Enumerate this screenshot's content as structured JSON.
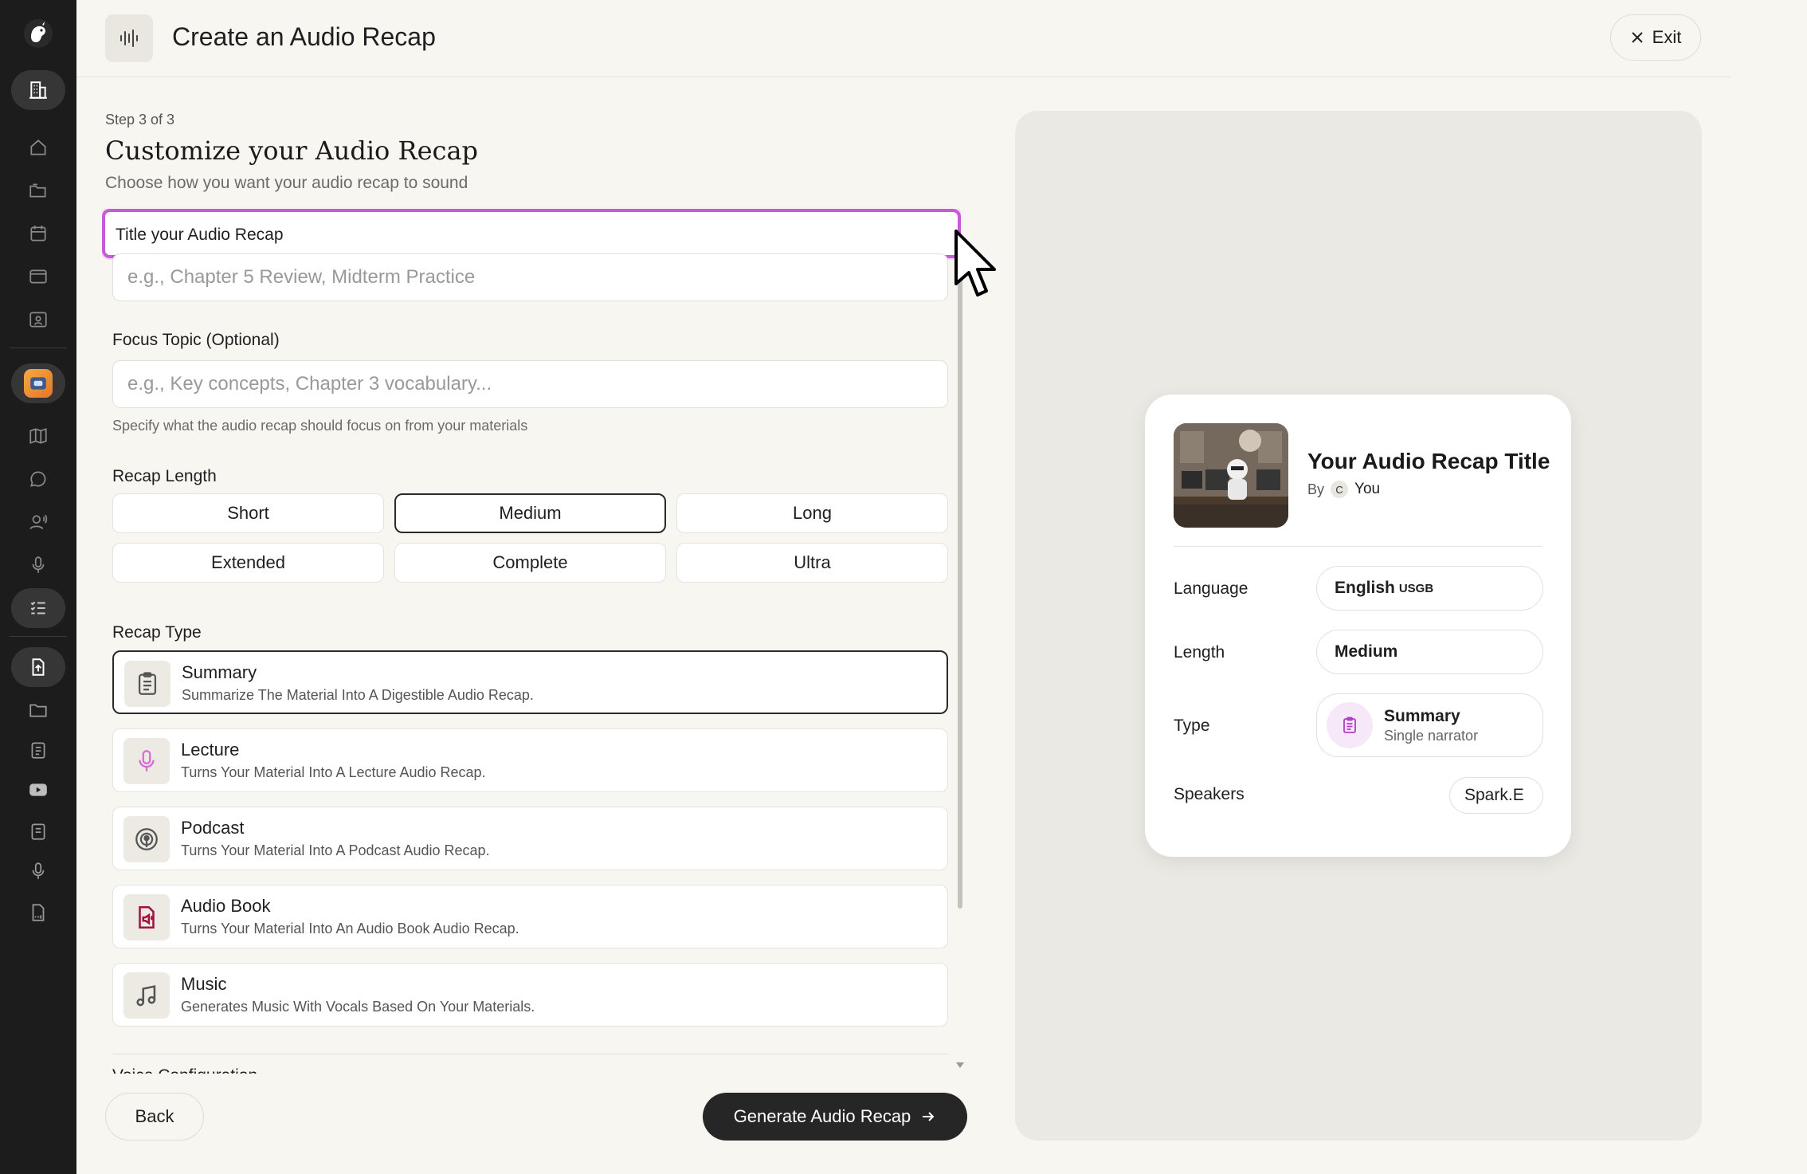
{
  "header": {
    "title": "Create an Audio Recap",
    "exit_label": "Exit"
  },
  "form": {
    "step": "Step 3 of 3",
    "title": "Customize your Audio Recap",
    "subtitle": "Choose how you want your audio recap to sound",
    "recap_title": {
      "label": "Title your Audio Recap",
      "placeholder": "e.g., Chapter 5 Review, Midterm Practice",
      "value": ""
    },
    "focus_topic": {
      "label": "Focus Topic (Optional)",
      "placeholder": "e.g., Key concepts, Chapter 3 vocabulary...",
      "hint": "Specify what the audio recap should focus on from your materials"
    },
    "recap_length": {
      "label": "Recap Length",
      "options": [
        "Short",
        "Medium",
        "Long",
        "Extended",
        "Complete",
        "Ultra"
      ],
      "selected": "Medium"
    },
    "recap_type": {
      "label": "Recap Type",
      "options": [
        {
          "name": "Summary",
          "desc": "Summarize The Material Into A Digestible Audio Recap.",
          "icon": "clipboard-icon",
          "icon_color": "#555555"
        },
        {
          "name": "Lecture",
          "desc": "Turns Your Material Into A Lecture Audio Recap.",
          "icon": "microphone-icon",
          "icon_color": "#d86ad8"
        },
        {
          "name": "Podcast",
          "desc": "Turns Your Material Into A Podcast Audio Recap.",
          "icon": "podcast-icon",
          "icon_color": "#555555"
        },
        {
          "name": "Audio Book",
          "desc": "Turns Your Material Into An Audio Book Audio Recap.",
          "icon": "audio-book-icon",
          "icon_color": "#a4123f"
        },
        {
          "name": "Music",
          "desc": "Generates Music With Vocals Based On Your Materials.",
          "icon": "music-note-icon",
          "icon_color": "#555555"
        }
      ],
      "selected": "Summary"
    },
    "next_section_label": "Voice Configuration"
  },
  "footer": {
    "back_label": "Back",
    "generate_label": "Generate Audio Recap"
  },
  "preview": {
    "title": "Your Audio Recap Title",
    "by_label": "By",
    "author_initial": "C",
    "author": "You",
    "language_label": "Language",
    "language_value": "English",
    "language_variant": "USGB",
    "length_label": "Length",
    "length_value": "Medium",
    "type_label": "Type",
    "type_value": "Summary",
    "type_sub": "Single narrator",
    "speakers_label": "Speakers",
    "speakers_value": "Spark.E"
  },
  "colors": {
    "accent": "#c75ad9",
    "dark_button": "#262626",
    "sidebar": "#1c1c1c",
    "background": "#f7f6f1"
  }
}
